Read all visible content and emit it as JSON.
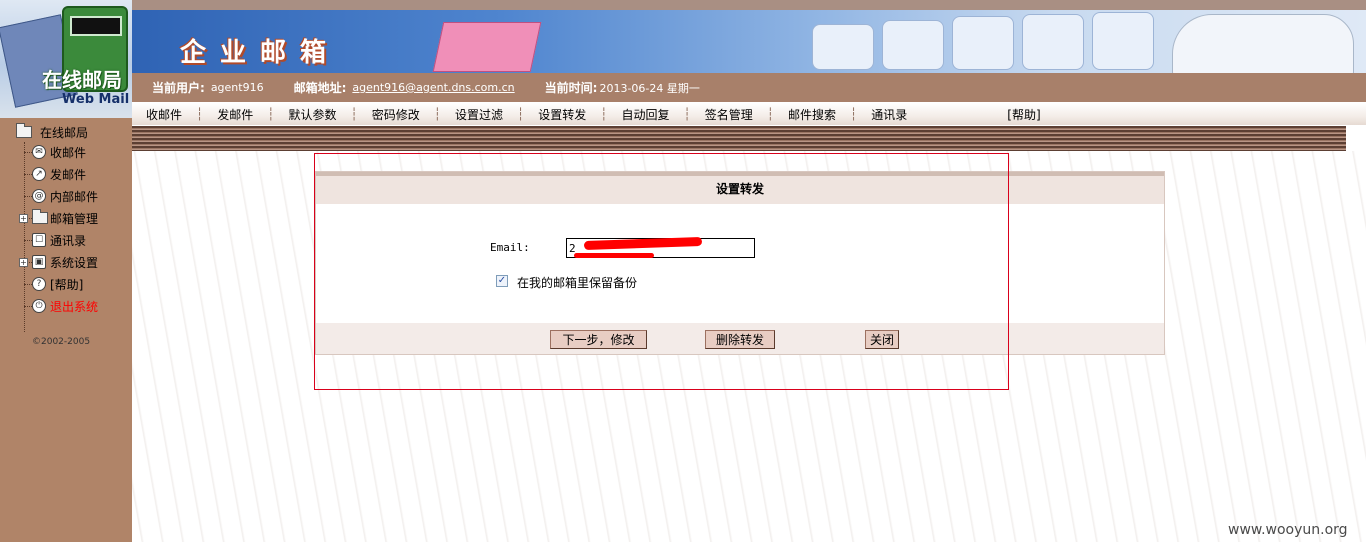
{
  "logo": {
    "text_cn": "在线邮局",
    "text_en": "Web Mail"
  },
  "banner": {
    "title": "企业邮箱"
  },
  "infobar": {
    "user_label": "当前用户:",
    "user_value": "agent916",
    "email_label": "邮箱地址:",
    "email_value": "agent916@agent.dns.com.cn",
    "time_label": "当前时间:",
    "time_value": "2013-06-24 星期一"
  },
  "menu": {
    "items": [
      "收邮件",
      "发邮件",
      "默认参数",
      "密码修改",
      "设置过滤",
      "设置转发",
      "自动回复",
      "签名管理",
      "邮件搜索",
      "通讯录"
    ],
    "help": "[帮助]"
  },
  "sidebar": {
    "root": "在线邮局",
    "items": [
      "收邮件",
      "发邮件",
      "内部邮件",
      "邮箱管理",
      "通讯录",
      "系统设置",
      "[帮助]",
      "退出系统"
    ],
    "copyright": "©2002-2005"
  },
  "dialog": {
    "title": "设置转发",
    "email_label": "Email:",
    "email_value": "2",
    "keep_copy_label": "在我的邮箱里保留备份",
    "keep_copy_checked": true,
    "buttons": {
      "next": "下一步，修改",
      "delete": "删除转发",
      "close": "关闭"
    }
  },
  "watermark": "www.wooyun.org",
  "colors": {
    "sidebar": "#b08468",
    "infobar": "#a8806a",
    "annotation": "#d9001b",
    "exit": "#ff0000"
  }
}
